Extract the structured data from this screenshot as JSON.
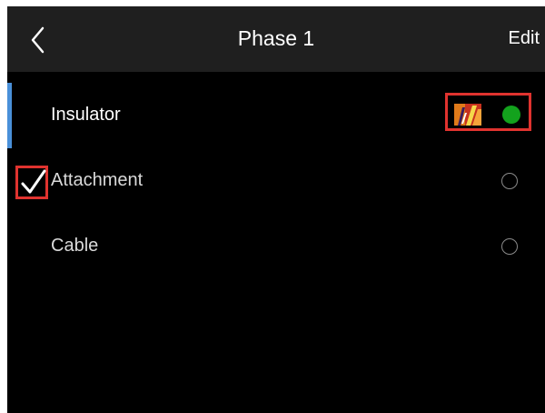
{
  "header": {
    "title": "Phase 1",
    "edit_label": "Edit",
    "back_icon": "chevron-left-icon"
  },
  "items": [
    {
      "label": "Insulator",
      "selected": true,
      "status": "filled-green",
      "has_thermal_image": true
    },
    {
      "label": "Attachment",
      "selected": false,
      "checked": true,
      "status": "empty"
    },
    {
      "label": "Cable",
      "selected": false,
      "status": "empty"
    }
  ],
  "colors": {
    "background": "#000000",
    "header": "#1f1f1f",
    "accent": "#4a90d9",
    "status_green": "#13a21d",
    "highlight_red": "#e0332f"
  }
}
